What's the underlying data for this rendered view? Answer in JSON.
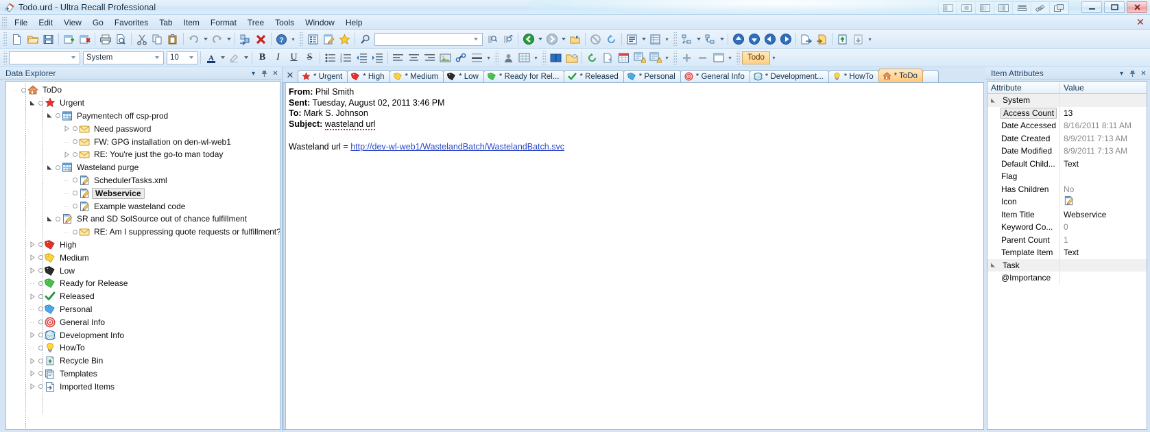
{
  "window": {
    "title": "Todo.urd - Ultra Recall Professional",
    "app_icon": "notebook-icon",
    "minimize": "0",
    "maximize": "1",
    "close": "✕",
    "layout_buttons": [
      "layout-left-icon",
      "layout-center-icon",
      "layout-right-icon",
      "layout-split-icon",
      "layout-horizontal-icon",
      "link-icon",
      "windows-icon"
    ]
  },
  "menu": {
    "items": [
      "File",
      "Edit",
      "View",
      "Go",
      "Favorites",
      "Tab",
      "Item",
      "Format",
      "Tree",
      "Tools",
      "Window",
      "Help"
    ],
    "close_label": "✕"
  },
  "toolbar1": {
    "buttons": [
      "new-icon",
      "open-icon",
      "save-icon",
      "new-item-icon",
      "delete-item-icon",
      "print-icon",
      "print-preview-icon",
      "cut-icon",
      "copy-icon",
      "paste-icon",
      "undo-icon",
      "redo-icon",
      "insert-icon",
      "delete-icon",
      "help-icon",
      "outline-icon",
      "edit-item-icon",
      "favorite-icon",
      "search-icon"
    ],
    "search_value": "",
    "find_buttons": [
      "find-icon",
      "find-next-icon",
      "back-icon",
      "forward-icon",
      "open-folder-icon",
      "stop-icon",
      "refresh-icon",
      "view-icon",
      "grid-icon"
    ],
    "nav_buttons": [
      "expand-icon",
      "collapse-icon",
      "move-up-icon",
      "move-down-icon",
      "move-left-icon",
      "move-right-icon",
      "export-icon",
      "import-icon",
      "check-in-icon",
      "check-out-icon"
    ]
  },
  "toolbar2": {
    "style_value": "",
    "font_value": "System",
    "size_value": "10",
    "buttons": [
      "font-color-icon",
      "highlight-icon",
      "bold-icon",
      "italic-icon",
      "underline-icon",
      "strikethrough-icon",
      "bullets-icon",
      "numbering-icon",
      "decrease-indent-icon",
      "increase-indent-icon",
      "align-left-icon",
      "align-center-icon",
      "align-right-icon",
      "insert-table-icon",
      "insert-image-icon",
      "insert-link-icon",
      "horizontal-rule-icon",
      "spell-check-icon",
      "zoom-icon",
      "book-icon",
      "folder-icon",
      "refresh-icon",
      "page-icon",
      "calendar-icon",
      "reminder-icon",
      "alarm-icon",
      "plus-icon",
      "minus-icon",
      "window-icon"
    ],
    "tag_label": "Todo"
  },
  "explorer": {
    "title": "Data Explorer",
    "header_buttons": [
      "chevron-down-icon",
      "pin-icon",
      "close-icon"
    ],
    "tree": [
      {
        "label": "ToDo",
        "icon": "home-icon",
        "indent": 0,
        "expander": "",
        "bold": false,
        "selected": false
      },
      {
        "label": "Urgent",
        "icon": "star-red-icon",
        "indent": 1,
        "expander": "expanded",
        "bold": false,
        "selected": false
      },
      {
        "label": "Paymentech off csp-prod",
        "icon": "table-icon",
        "indent": 2,
        "expander": "expanded",
        "bold": false,
        "selected": false
      },
      {
        "label": "Need password",
        "icon": "mail-icon",
        "indent": 3,
        "expander": "collapsed",
        "bold": false,
        "selected": false
      },
      {
        "label": "FW: GPG installation on den-wl-web1",
        "icon": "mail-icon",
        "indent": 3,
        "expander": "",
        "bold": false,
        "selected": false
      },
      {
        "label": "RE: You're just the go-to man today",
        "icon": "mail-icon",
        "indent": 3,
        "expander": "collapsed",
        "bold": false,
        "selected": false
      },
      {
        "label": "Wasteland purge",
        "icon": "table-icon",
        "indent": 2,
        "expander": "expanded",
        "bold": false,
        "selected": false
      },
      {
        "label": "SchedulerTasks.xml",
        "icon": "note-icon",
        "indent": 3,
        "expander": "",
        "bold": false,
        "selected": false
      },
      {
        "label": "Webservice",
        "icon": "note-icon",
        "indent": 3,
        "expander": "",
        "bold": true,
        "selected": true
      },
      {
        "label": "Example wasteland code",
        "icon": "note-icon",
        "indent": 3,
        "expander": "",
        "bold": false,
        "selected": false
      },
      {
        "label": "SR and SD SolSource out of chance fulfillment",
        "icon": "note-icon",
        "indent": 2,
        "expander": "expanded",
        "bold": false,
        "selected": false
      },
      {
        "label": "RE: Am I suppressing quote requests or fulfillment?",
        "icon": "mail-icon",
        "indent": 3,
        "expander": "",
        "bold": false,
        "selected": false
      },
      {
        "label": "High",
        "icon": "tag-red-icon",
        "indent": 1,
        "expander": "collapsed",
        "bold": false,
        "selected": false
      },
      {
        "label": "Medium",
        "icon": "tag-yellow-icon",
        "indent": 1,
        "expander": "collapsed",
        "bold": false,
        "selected": false
      },
      {
        "label": "Low",
        "icon": "tag-black-icon",
        "indent": 1,
        "expander": "collapsed",
        "bold": false,
        "selected": false
      },
      {
        "label": "Ready for Release",
        "icon": "tag-green-icon",
        "indent": 1,
        "expander": "",
        "bold": false,
        "selected": false
      },
      {
        "label": "Released",
        "icon": "check-green-icon",
        "indent": 1,
        "expander": "collapsed",
        "bold": false,
        "selected": false
      },
      {
        "label": "Personal",
        "icon": "tag-blue-icon",
        "indent": 1,
        "expander": "",
        "bold": false,
        "selected": false
      },
      {
        "label": "General Info",
        "icon": "target-icon",
        "indent": 1,
        "expander": "",
        "bold": false,
        "selected": false
      },
      {
        "label": "Development Info",
        "icon": "globe-icon",
        "indent": 1,
        "expander": "collapsed",
        "bold": false,
        "selected": false
      },
      {
        "label": "HowTo",
        "icon": "bulb-icon",
        "indent": 1,
        "expander": "",
        "bold": false,
        "selected": false
      },
      {
        "label": "Recycle Bin",
        "icon": "recycle-icon",
        "indent": 1,
        "expander": "collapsed",
        "bold": false,
        "selected": false
      },
      {
        "label": "Templates",
        "icon": "templates-icon",
        "indent": 1,
        "expander": "collapsed",
        "bold": false,
        "selected": false
      },
      {
        "label": "Imported Items",
        "icon": "imported-icon",
        "indent": 1,
        "expander": "collapsed",
        "bold": false,
        "selected": false
      }
    ]
  },
  "tabs": {
    "close_label": "✕",
    "items": [
      {
        "label": "* Urgent",
        "icon": "star-red-icon",
        "active": false
      },
      {
        "label": "* High",
        "icon": "tag-red-icon",
        "active": false
      },
      {
        "label": "* Medium",
        "icon": "tag-yellow-icon",
        "active": false
      },
      {
        "label": "* Low",
        "icon": "tag-black-icon",
        "active": false
      },
      {
        "label": "* Ready for Rel...",
        "icon": "tag-green-icon",
        "active": false
      },
      {
        "label": "* Released",
        "icon": "check-green-icon",
        "active": false
      },
      {
        "label": "* Personal",
        "icon": "tag-blue-icon",
        "active": false
      },
      {
        "label": "* General Info",
        "icon": "target-icon",
        "active": false
      },
      {
        "label": "* Development...",
        "icon": "globe-icon",
        "active": false
      },
      {
        "label": "* HowTo",
        "icon": "bulb-icon",
        "active": false
      },
      {
        "label": "* ToDo",
        "icon": "home-icon",
        "active": true
      }
    ]
  },
  "editor": {
    "headers": [
      {
        "label": "From:",
        "value": "Phil Smith"
      },
      {
        "label": "Sent:",
        "value": "Tuesday, August 02, 2011 3:46 PM"
      },
      {
        "label": "To:",
        "value": "Mark S. Johnson"
      },
      {
        "label": "Subject:",
        "value": "wasteland url"
      }
    ],
    "body_prefix": "Wasteland url = ",
    "body_link": "http://dev-wl-web1/WastelandBatch/WastelandBatch.svc"
  },
  "attributes": {
    "title": "Item Attributes",
    "header_buttons": [
      "chevron-down-icon",
      "pin-icon",
      "close-icon"
    ],
    "columns": [
      "Attribute",
      "Value"
    ],
    "rows": [
      {
        "kind": "group",
        "name": "System",
        "value": ""
      },
      {
        "kind": "item",
        "name": "Access Count",
        "value": "13",
        "dim": false,
        "selected": true
      },
      {
        "kind": "item",
        "name": "Date Accessed",
        "value": "8/16/2011 8:11 AM",
        "dim": true,
        "selected": false
      },
      {
        "kind": "item",
        "name": "Date Created",
        "value": "8/9/2011 7:13 AM",
        "dim": true,
        "selected": false
      },
      {
        "kind": "item",
        "name": "Date Modified",
        "value": "8/9/2011 7:13 AM",
        "dim": true,
        "selected": false
      },
      {
        "kind": "item",
        "name": "Default Child...",
        "value": "Text",
        "dim": false,
        "selected": false
      },
      {
        "kind": "item",
        "name": "Flag",
        "value": "",
        "dim": false,
        "selected": false
      },
      {
        "kind": "item",
        "name": "Has Children",
        "value": "No",
        "dim": true,
        "selected": false
      },
      {
        "kind": "icon",
        "name": "Icon",
        "value": "",
        "dim": false,
        "selected": false
      },
      {
        "kind": "item",
        "name": "Item Title",
        "value": "Webservice",
        "dim": false,
        "selected": false
      },
      {
        "kind": "item",
        "name": "Keyword Co...",
        "value": "0",
        "dim": true,
        "selected": false
      },
      {
        "kind": "item",
        "name": "Parent Count",
        "value": "1",
        "dim": true,
        "selected": false
      },
      {
        "kind": "item",
        "name": "Template Item",
        "value": "Text",
        "dim": false,
        "selected": false
      },
      {
        "kind": "group",
        "name": "Task",
        "value": ""
      },
      {
        "kind": "item",
        "name": "@Importance",
        "value": "",
        "dim": false,
        "selected": false
      }
    ]
  },
  "colors": {
    "accent": "#ffc877",
    "link": "#2b47c8",
    "panel_title": "#15406b",
    "chrome": "#d6e5f5"
  }
}
